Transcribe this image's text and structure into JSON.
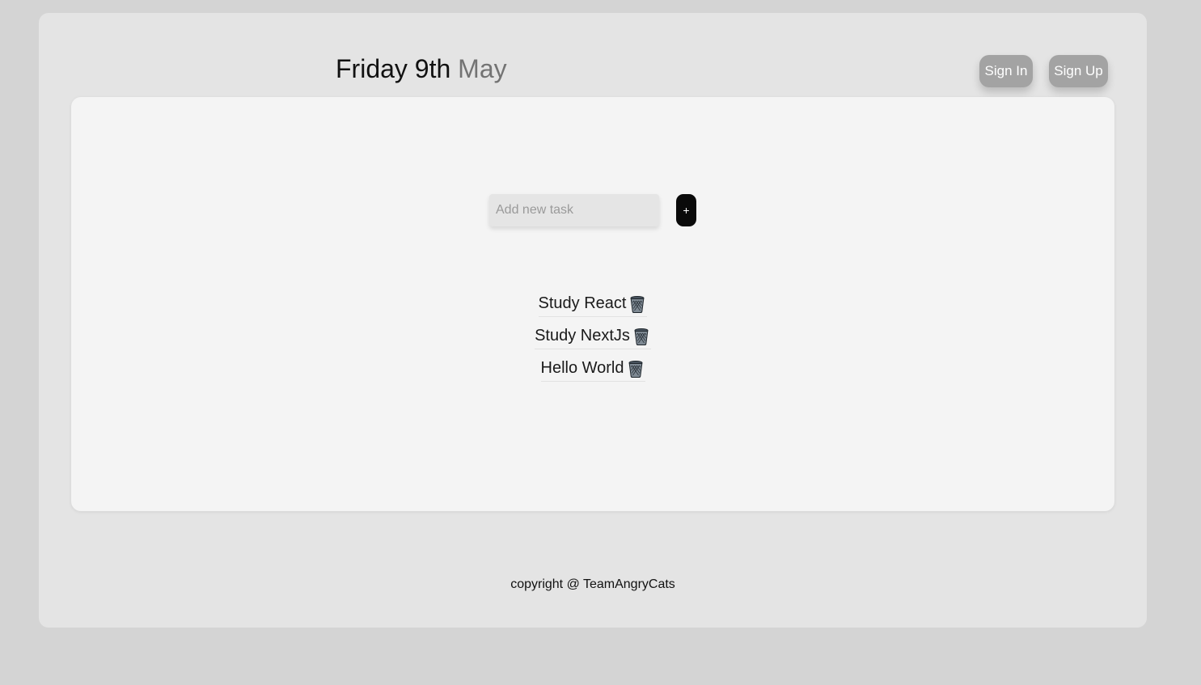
{
  "header": {
    "date_prefix": "Friday 9th",
    "date_month": "May",
    "signin_label": "Sign In",
    "signup_label": "Sign Up"
  },
  "task_form": {
    "placeholder": "Add new task",
    "value": "",
    "add_label": "+"
  },
  "tasks": [
    {
      "text": "Study React",
      "icon": "trash-icon"
    },
    {
      "text": "Study NextJs",
      "icon": "trash-icon"
    },
    {
      "text": "Hello World",
      "icon": "trash-icon"
    }
  ],
  "footer": {
    "copyright": "copyright @ TeamAngryCats"
  },
  "colors": {
    "page_background": "#d4d4d4",
    "frame_background": "#e4e4e4",
    "card_background": "#f4f4f4",
    "auth_button": "#a3a3a3",
    "add_button": "#0a0a0a",
    "month_text": "#737373"
  }
}
